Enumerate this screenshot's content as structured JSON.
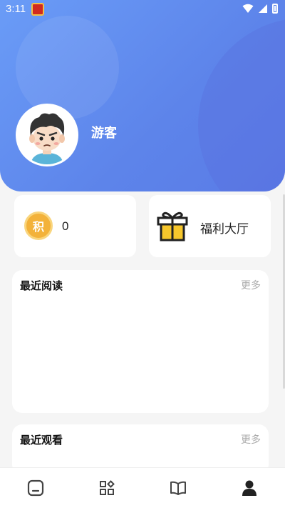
{
  "status_bar": {
    "time": "3:11",
    "icons": [
      "app-notification-icon",
      "wifi-icon",
      "signal-icon",
      "battery-icon"
    ]
  },
  "profile": {
    "username": "游客",
    "avatar": "cartoon-boy-avatar"
  },
  "points_card": {
    "badge": "积",
    "value": "0"
  },
  "welfare_card": {
    "label": "福利大厅",
    "icon": "gift-box-icon"
  },
  "recent_read": {
    "title": "最近阅读",
    "more": "更多"
  },
  "recent_watch": {
    "title": "最近观看",
    "more": "更多"
  },
  "bottom_nav": {
    "items": [
      {
        "name": "home",
        "icon": "home-icon",
        "active": false
      },
      {
        "name": "category",
        "icon": "apps-icon",
        "active": false
      },
      {
        "name": "bookshelf",
        "icon": "book-open-icon",
        "active": false
      },
      {
        "name": "profile",
        "icon": "person-icon",
        "active": true
      }
    ]
  },
  "colors": {
    "header_start": "#6a9cf7",
    "header_end": "#5a7be6",
    "coin": "#f3b23a",
    "gift": "#f7c72c",
    "active_nav": "#222222",
    "inactive_nav": "#444444"
  }
}
